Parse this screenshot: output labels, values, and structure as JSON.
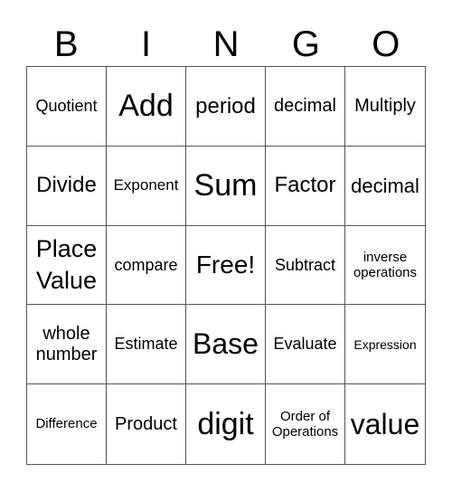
{
  "header": [
    "B",
    "I",
    "N",
    "G",
    "O"
  ],
  "cells": [
    "Quotient",
    "Add",
    "period",
    "decimal",
    "Multiply",
    "Divide",
    "Exponent",
    "Sum",
    "Factor",
    "decimal",
    "Place Value",
    "compare",
    "Free!",
    "Subtract",
    "inverse operations",
    "whole number",
    "Estimate",
    "Base",
    "Evaluate",
    "Expression",
    "Difference",
    "Product",
    "digit",
    "Order of Operations",
    "value"
  ]
}
